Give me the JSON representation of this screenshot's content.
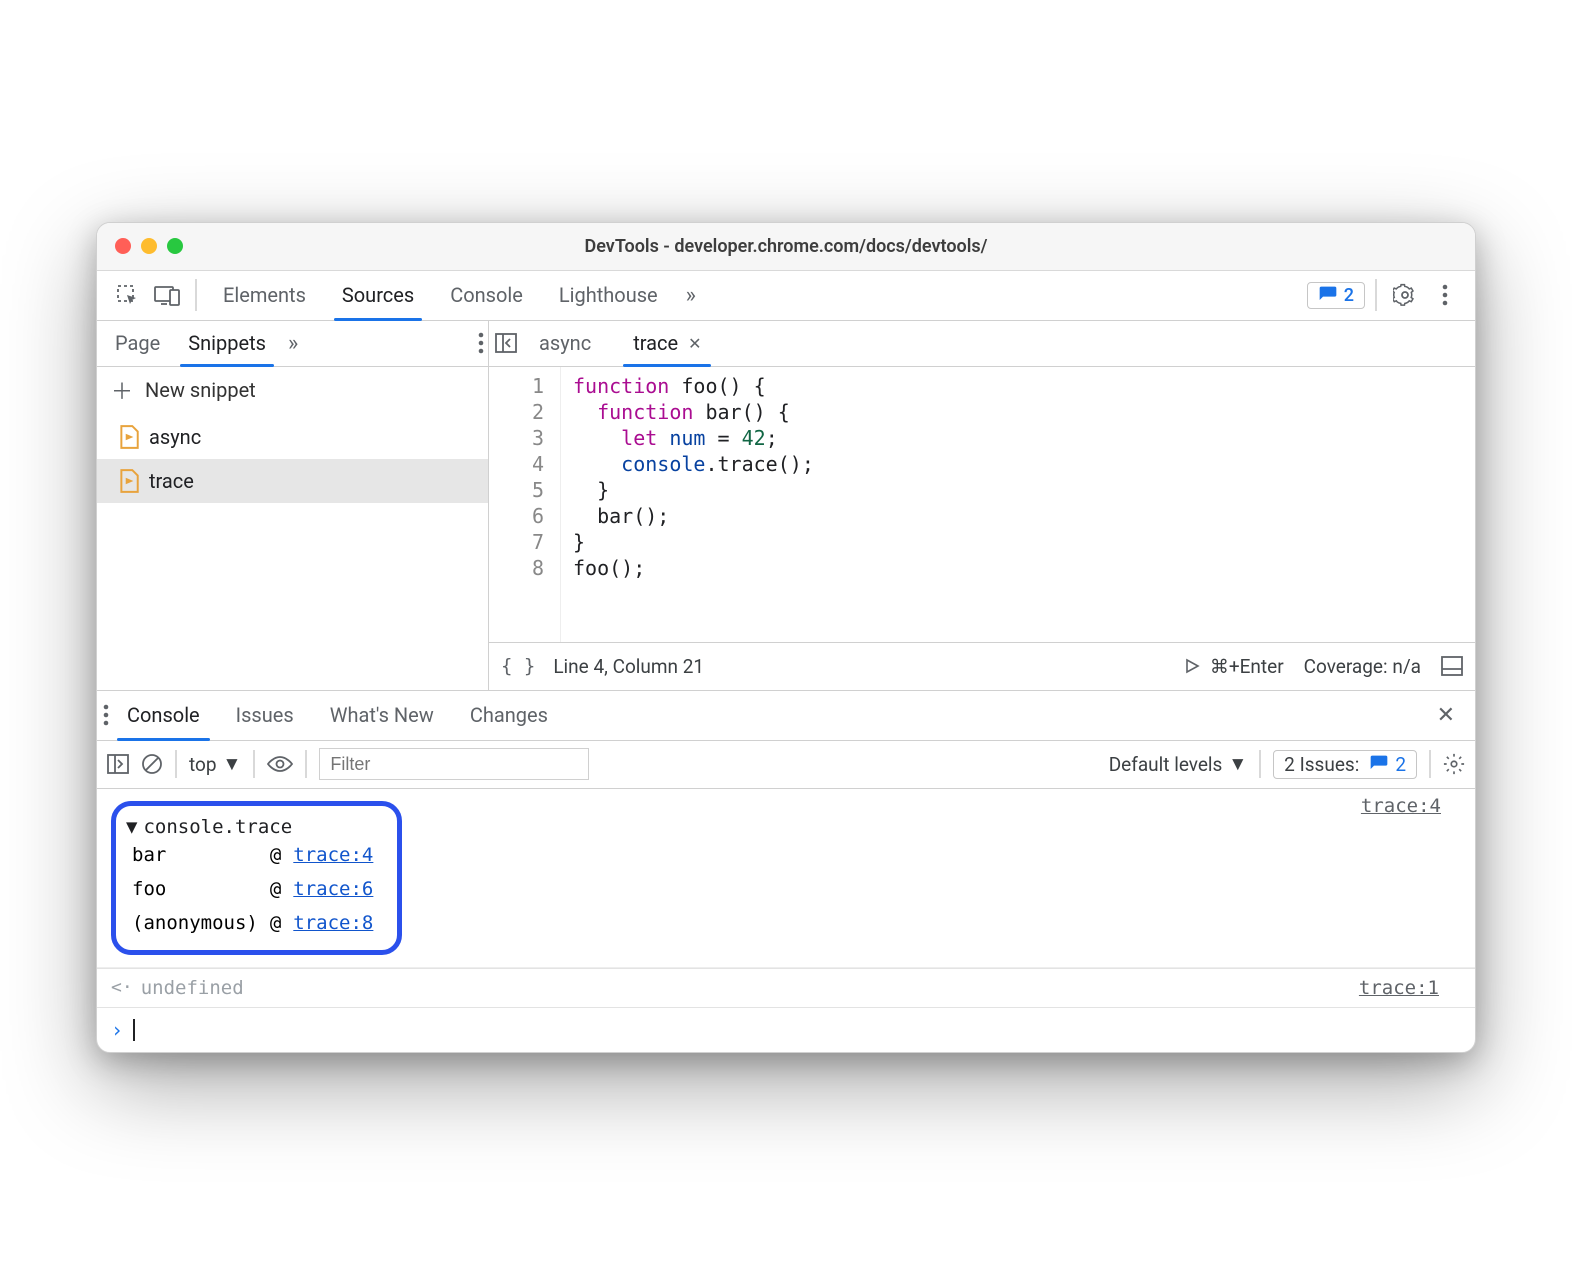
{
  "window": {
    "title": "DevTools - developer.chrome.com/docs/devtools/"
  },
  "mainTabs": {
    "items": [
      "Elements",
      "Sources",
      "Console",
      "Lighthouse"
    ],
    "activeIndex": 1,
    "issuesBadge": "2"
  },
  "sidebar": {
    "tabs": [
      "Page",
      "Snippets"
    ],
    "activeIndex": 1,
    "newSnippet": "New snippet",
    "snippets": [
      "async",
      "trace"
    ],
    "selectedIndex": 1
  },
  "editor": {
    "tabs": [
      {
        "name": "async",
        "active": false,
        "closable": false
      },
      {
        "name": "trace",
        "active": true,
        "closable": true
      }
    ],
    "lines": [
      "1",
      "2",
      "3",
      "4",
      "5",
      "6",
      "7",
      "8"
    ],
    "status": {
      "pos": "Line 4, Column 21",
      "run": "⌘+Enter",
      "coverage": "Coverage: n/a"
    }
  },
  "drawer": {
    "tabs": [
      "Console",
      "Issues",
      "What's New",
      "Changes"
    ],
    "activeIndex": 0
  },
  "consoleToolbar": {
    "context": "top",
    "filterPlaceholder": "Filter",
    "levels": "Default levels",
    "issuesLabel": "2 Issues:",
    "issuesCount": "2"
  },
  "consoleOutput": {
    "traceLabel": "console.trace",
    "traceSrc": "trace:4",
    "frames": [
      {
        "fn": "bar",
        "at": "trace:4"
      },
      {
        "fn": "foo",
        "at": "trace:6"
      },
      {
        "fn": "(anonymous)",
        "at": "trace:8"
      }
    ],
    "undef": "undefined",
    "undefSrc": "trace:1"
  }
}
